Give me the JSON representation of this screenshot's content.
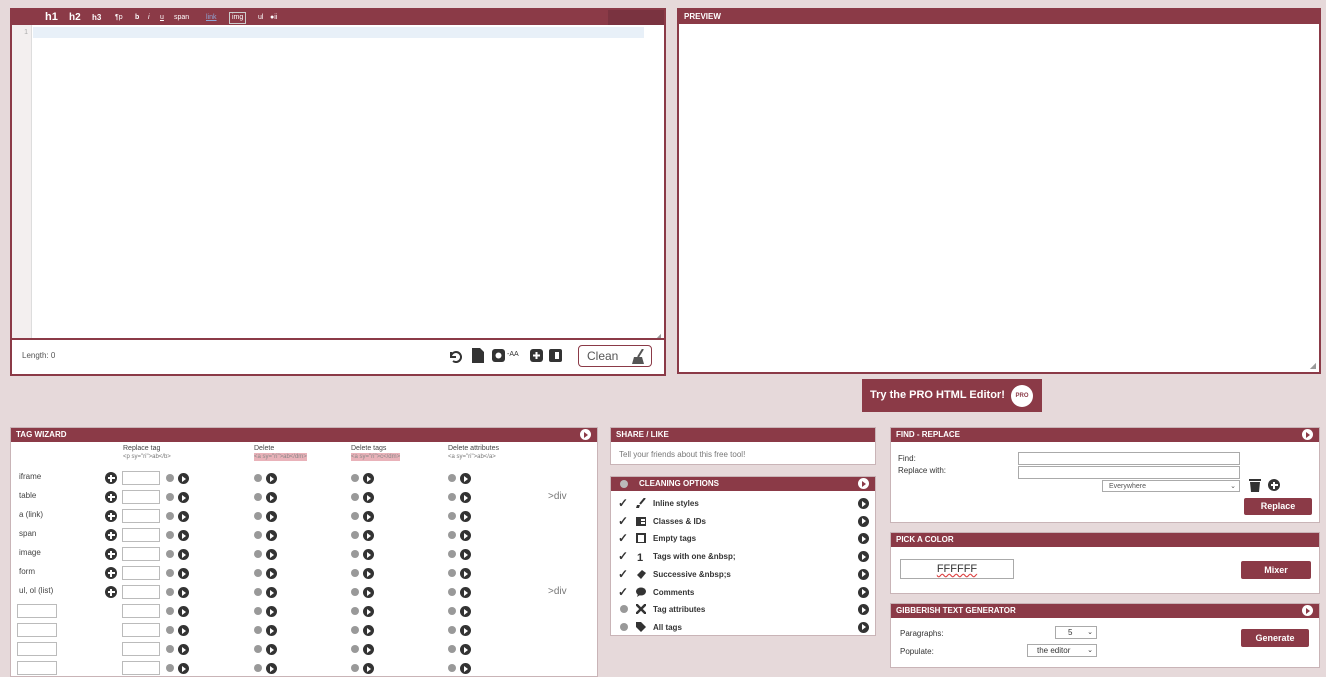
{
  "toolbar": {
    "h1": "h1",
    "h2": "h2",
    "h3": "h3",
    "p": "¶p",
    "b": "b",
    "i": "i",
    "u": "u",
    "span": "span",
    "link": "link",
    "img": "img",
    "ul": "ul",
    "ol": "●ii"
  },
  "editor": {
    "line_number": "1",
    "length_label": "Length: 0",
    "clean_label": "Clean",
    "case_label": "-AA"
  },
  "preview": {
    "title": "PREVIEW"
  },
  "pro": {
    "label": "Try the PRO HTML Editor!",
    "badge": "PRO"
  },
  "tag_wizard": {
    "title": "TAG WIZARD",
    "columns": [
      {
        "title": "Replace tag",
        "example": "<p sy=\"ri\">ab</b>"
      },
      {
        "title": "Delete",
        "example": "<a sy=\"ri\">ab</dm>"
      },
      {
        "title": "Delete tags",
        "example": "<a sy=\"ri\">c</dm>"
      },
      {
        "title": "Delete attributes",
        "example": "<a sy=\"ri\">ab</a>"
      }
    ],
    "rows": [
      {
        "label": "iframe",
        "extra": ""
      },
      {
        "label": "table",
        "extra": ">div"
      },
      {
        "label": "a (link)",
        "extra": ""
      },
      {
        "label": "span",
        "extra": ""
      },
      {
        "label": "image",
        "extra": ""
      },
      {
        "label": "form",
        "extra": ""
      },
      {
        "label": "ul, ol (list)",
        "extra": ">div"
      }
    ]
  },
  "share": {
    "title": "SHARE / LIKE",
    "text": "Tell your friends about this free tool!"
  },
  "cleaning": {
    "title": "CLEANING OPTIONS",
    "items": [
      {
        "label": "Inline styles",
        "checked": true,
        "icon": "brush-icon"
      },
      {
        "label": "Classes & IDs",
        "checked": true,
        "icon": "table-icon"
      },
      {
        "label": "Empty tags",
        "checked": true,
        "icon": "empty-box-icon"
      },
      {
        "label": "Tags with one &nbsp;",
        "checked": true,
        "icon": "one-icon"
      },
      {
        "label": "Successive &nbsp;s",
        "checked": true,
        "icon": "eraser-icon"
      },
      {
        "label": "Comments",
        "checked": true,
        "icon": "speech-bubble-icon"
      },
      {
        "label": "Tag attributes",
        "checked": false,
        "icon": "tools-icon"
      },
      {
        "label": "All tags",
        "checked": false,
        "icon": "tag-icon"
      }
    ]
  },
  "find_replace": {
    "title": "FIND - REPLACE",
    "find_label": "Find:",
    "replace_label": "Replace with:",
    "scope": "Everywhere",
    "button": "Replace"
  },
  "color": {
    "title": "PICK A COLOR",
    "value": "FFFFFF",
    "button": "Mixer"
  },
  "gibberish": {
    "title": "GIBBERISH TEXT GENERATOR",
    "paragraphs_label": "Paragraphs:",
    "paragraphs_value": "5",
    "populate_label": "Populate:",
    "populate_value": "the editor",
    "button": "Generate"
  },
  "colors": {
    "accent": "#8b3a47",
    "background": "#e6d9da"
  }
}
